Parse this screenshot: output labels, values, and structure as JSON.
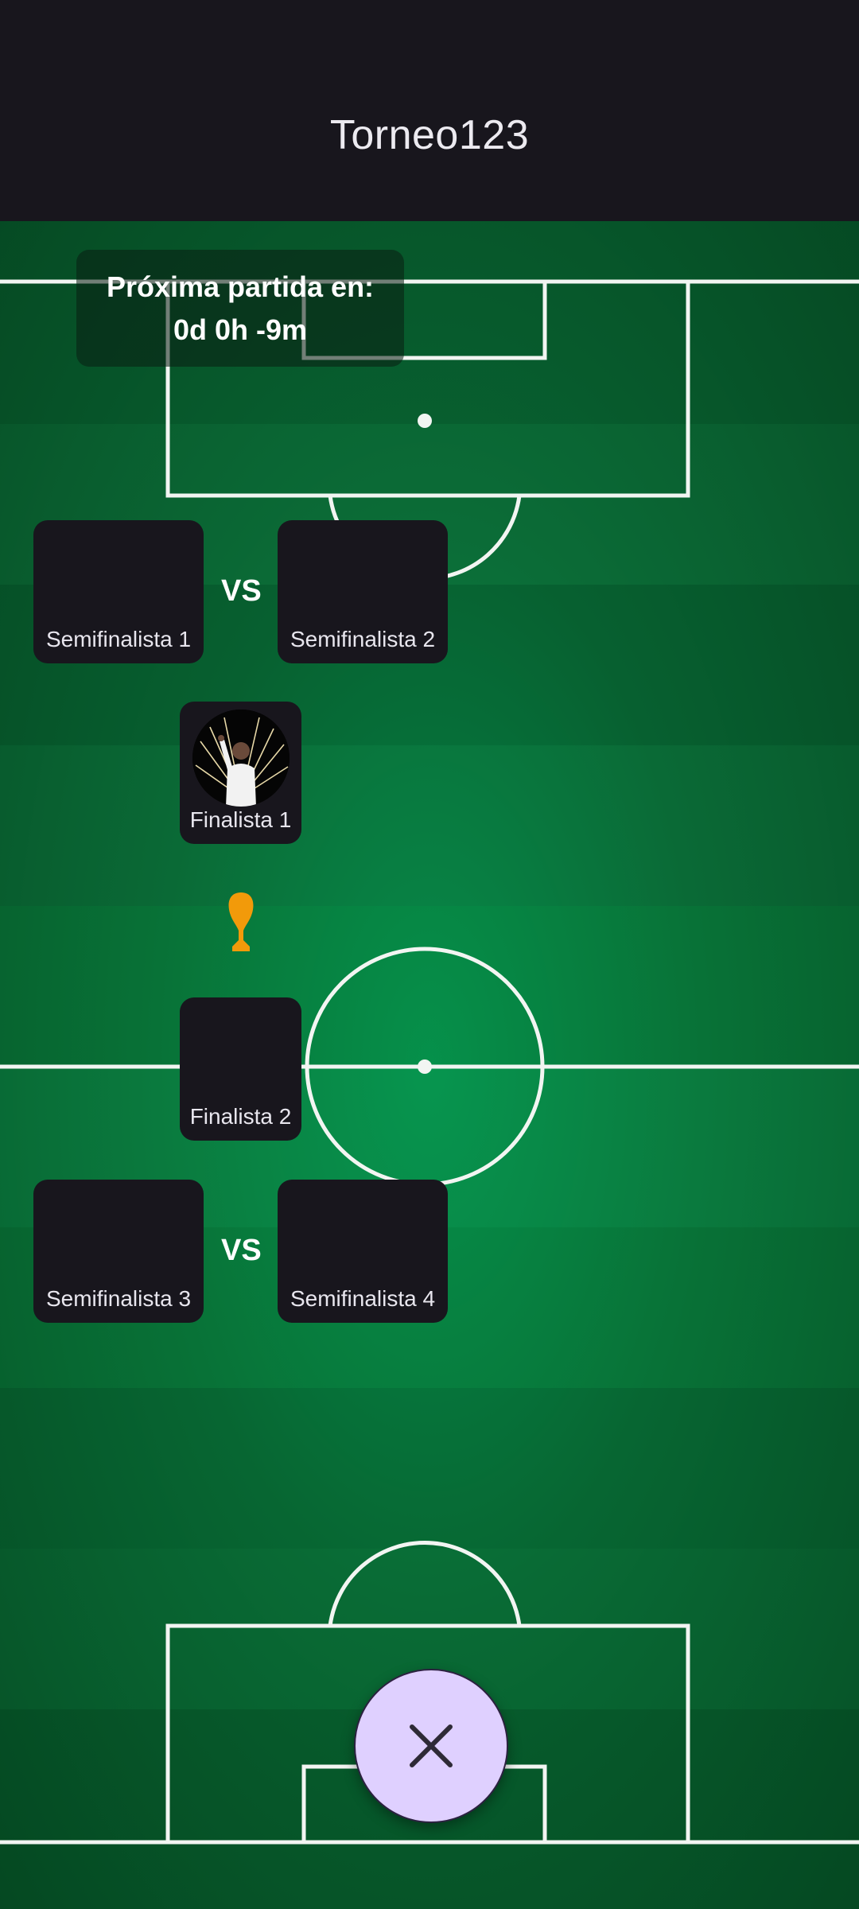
{
  "app": {
    "title": "Torneo123"
  },
  "countdown": {
    "line1": "Próxima partida en:",
    "line2": "0d 0h -9m"
  },
  "bracket": {
    "semifinal_top": {
      "left_label": "Semifinalista 1",
      "vs": "VS",
      "right_label": "Semifinalista 2"
    },
    "finalist_1": {
      "label": "Finalista 1",
      "has_avatar": true
    },
    "trophy_icon": "trophy-icon",
    "finalist_2": {
      "label": "Finalista 2"
    },
    "semifinal_bottom": {
      "left_label": "Semifinalista 3",
      "vs": "VS",
      "right_label": "Semifinalista 4"
    }
  },
  "fab": {
    "icon": "close-icon"
  },
  "colors": {
    "topbar": "#18161d",
    "card": "#18161d",
    "field": "#0a6a35",
    "trophy": "#f29a0a",
    "fab": "#dfd0ff"
  }
}
